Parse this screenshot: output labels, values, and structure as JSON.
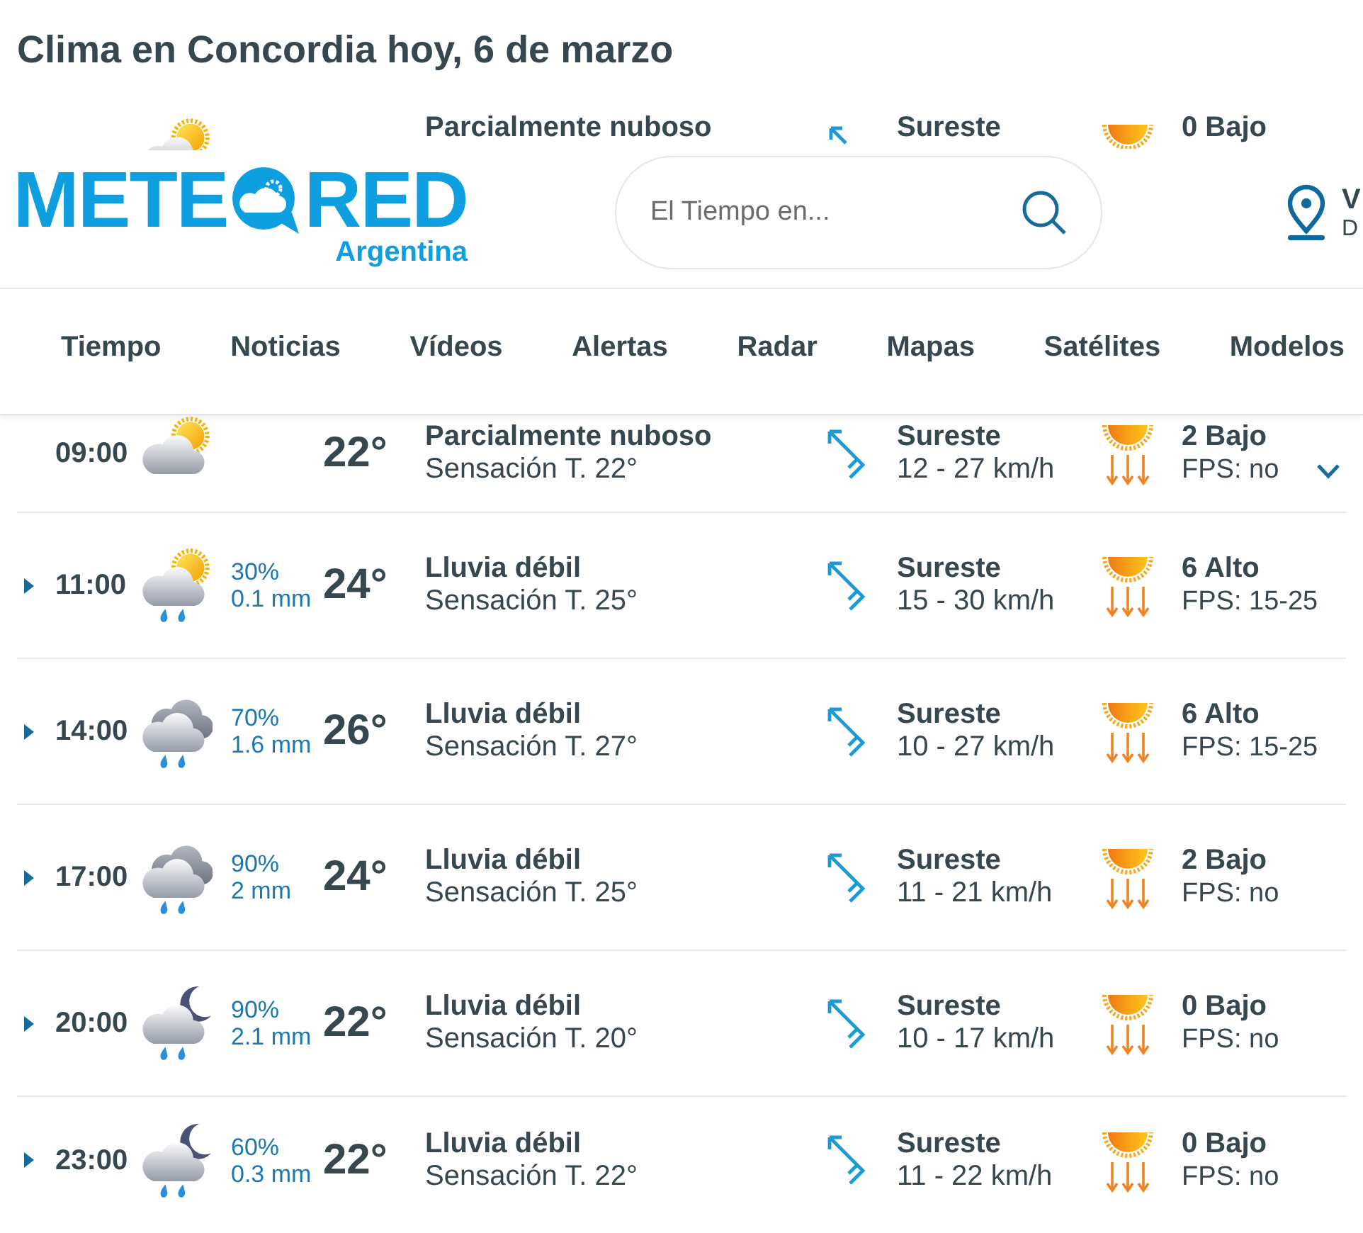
{
  "title": "Clima en Concordia hoy, 6 de marzo",
  "covered_row": {
    "condition": "Parcialmente nuboso",
    "wind_direction": "Sureste",
    "uv": "0 Bajo"
  },
  "header": {
    "logo": {
      "text_before": "METE",
      "text_after": "RED",
      "region": "Argentina"
    },
    "search": {
      "placeholder": "El Tiempo en..."
    },
    "location": {
      "line_1": "V",
      "line_2": "D"
    }
  },
  "nav": [
    {
      "label": "Tiempo"
    },
    {
      "label": "Noticias"
    },
    {
      "label": "Vídeos"
    },
    {
      "label": "Alertas"
    },
    {
      "label": "Radar"
    },
    {
      "label": "Mapas"
    },
    {
      "label": "Satélites"
    },
    {
      "label": "Modelos"
    }
  ],
  "hours": [
    {
      "time": "09:00",
      "kind": "partly_cloudy",
      "current": true,
      "temperature": "22°",
      "condition": "Parcialmente nuboso",
      "feels_like": "Sensación T. 22°",
      "wind_direction": "Sureste",
      "wind_speed": "12 - 27 km/h",
      "uv": "2 Bajo",
      "protection": "FPS: no"
    },
    {
      "time": "11:00",
      "kind": "rain_sun",
      "current": false,
      "rain_chance": "30%",
      "rain_amount": "0.1 mm",
      "temperature": "24°",
      "condition": "Lluvia débil",
      "feels_like": "Sensación T. 25°",
      "wind_direction": "Sureste",
      "wind_speed": "15 - 30 km/h",
      "uv": "6 Alto",
      "protection": "FPS: 15-25"
    },
    {
      "time": "14:00",
      "kind": "rain_cloud",
      "current": false,
      "rain_chance": "70%",
      "rain_amount": "1.6 mm",
      "temperature": "26°",
      "condition": "Lluvia débil",
      "feels_like": "Sensación T. 27°",
      "wind_direction": "Sureste",
      "wind_speed": "10 - 27 km/h",
      "uv": "6 Alto",
      "protection": "FPS: 15-25"
    },
    {
      "time": "17:00",
      "kind": "rain_cloud",
      "current": false,
      "rain_chance": "90%",
      "rain_amount": "2 mm",
      "temperature": "24°",
      "condition": "Lluvia débil",
      "feels_like": "Sensación T. 25°",
      "wind_direction": "Sureste",
      "wind_speed": "11 - 21 km/h",
      "uv": "2 Bajo",
      "protection": "FPS: no"
    },
    {
      "time": "20:00",
      "kind": "rain_moon",
      "current": false,
      "rain_chance": "90%",
      "rain_amount": "2.1 mm",
      "temperature": "22°",
      "condition": "Lluvia débil",
      "feels_like": "Sensación T. 20°",
      "wind_direction": "Sureste",
      "wind_speed": "10 - 17 km/h",
      "uv": "0 Bajo",
      "protection": "FPS: no"
    },
    {
      "time": "23:00",
      "kind": "rain_moon",
      "current": false,
      "rain_chance": "60%",
      "rain_amount": "0.3 mm",
      "temperature": "22°",
      "condition": "Lluvia débil",
      "feels_like": "Sensación T. 22°",
      "wind_direction": "Sureste",
      "wind_speed": "11 - 22 km/h",
      "uv": "0 Bajo",
      "protection": "FPS: no"
    }
  ]
}
